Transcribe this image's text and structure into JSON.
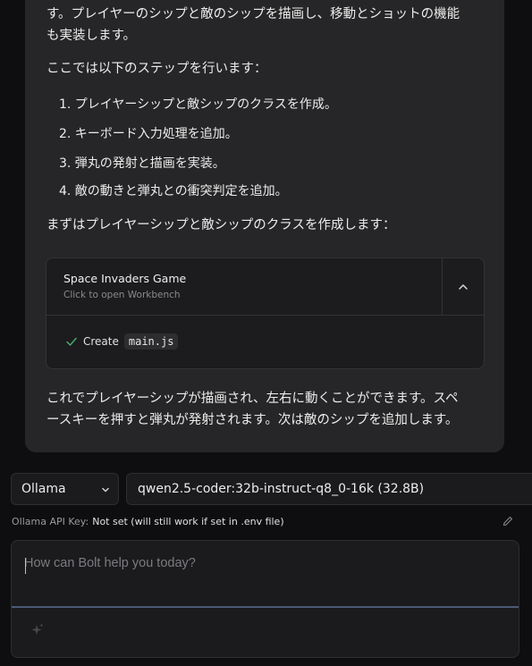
{
  "message": {
    "intro_line1": "す。プレイヤーのシップと敵のシップを描画し、移動とショットの機能",
    "intro_line2": "も実装します。",
    "steps_intro": "ここでは以下のステップを行います：",
    "steps": [
      "1. プレイヤーシップと敵シップのクラスを作成。",
      "2. キーボード入力処理を追加。",
      "3. 弾丸の発射と描画を実装。",
      "4. 敵の動きと弾丸との衝突判定を追加。"
    ],
    "lead": "まずはプレイヤーシップと敵シップのクラスを作成します：",
    "outro_line1": "これでプレイヤーシップが描画され、左右に動くことができます。スペ",
    "outro_line2": "ースキーを押すと弾丸が発射されます。次は敵のシップを追加します。"
  },
  "artifact": {
    "title": "Space Invaders Game",
    "subtitle": "Click to open Workbench",
    "action_label": "Create",
    "file": "main.js"
  },
  "controls": {
    "provider": "Ollama",
    "model": "qwen2.5-coder:32b-instruct-q8_0-16k (32.8B)",
    "api_key_label": "Ollama API Key:",
    "api_key_value": "Not set (will still work if set in .env file)"
  },
  "prompt": {
    "placeholder": "How can Bolt help you today?"
  },
  "icons": {
    "collapse": "chevron-up-icon",
    "check": "check-icon",
    "dropdown": "chevron-down-icon",
    "edit": "pencil-icon",
    "enhance": "sparkles-icon"
  },
  "colors": {
    "background": "#0e0e10",
    "bubble": "#262628",
    "panel": "#1b1b1d",
    "check": "#4caf72",
    "focus_line": "#4b5a78"
  }
}
